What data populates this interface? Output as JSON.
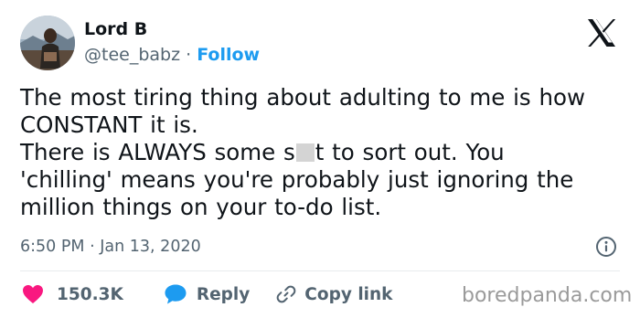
{
  "author": {
    "name": "Lord B",
    "handle": "@tee_babz",
    "separator": "·",
    "follow_label": "Follow"
  },
  "tweet": {
    "line1": "The most tiring thing about adulting to me is how\nCONSTANT it is.\nThere is ALWAYS some s",
    "line2": "t to sort out. You\n'chilling' means you're probably just ignoring the\nmillion things on your to-do list.",
    "time": "6:50 PM",
    "date_separator": "·",
    "date": "Jan 13, 2020"
  },
  "actions": {
    "likes": "150.3K",
    "reply_label": "Reply",
    "copy_link_label": "Copy link"
  },
  "watermark": "boredpanda.com",
  "colors": {
    "like": "#f91880",
    "reply": "#1d9bf0",
    "follow": "#1d9bf0",
    "text": "#0f1419",
    "muted": "#536471"
  },
  "icons": {
    "logo": "x-logo-icon",
    "info": "info-icon",
    "like": "heart-icon",
    "reply": "speech-bubble-icon",
    "copy": "link-icon"
  }
}
